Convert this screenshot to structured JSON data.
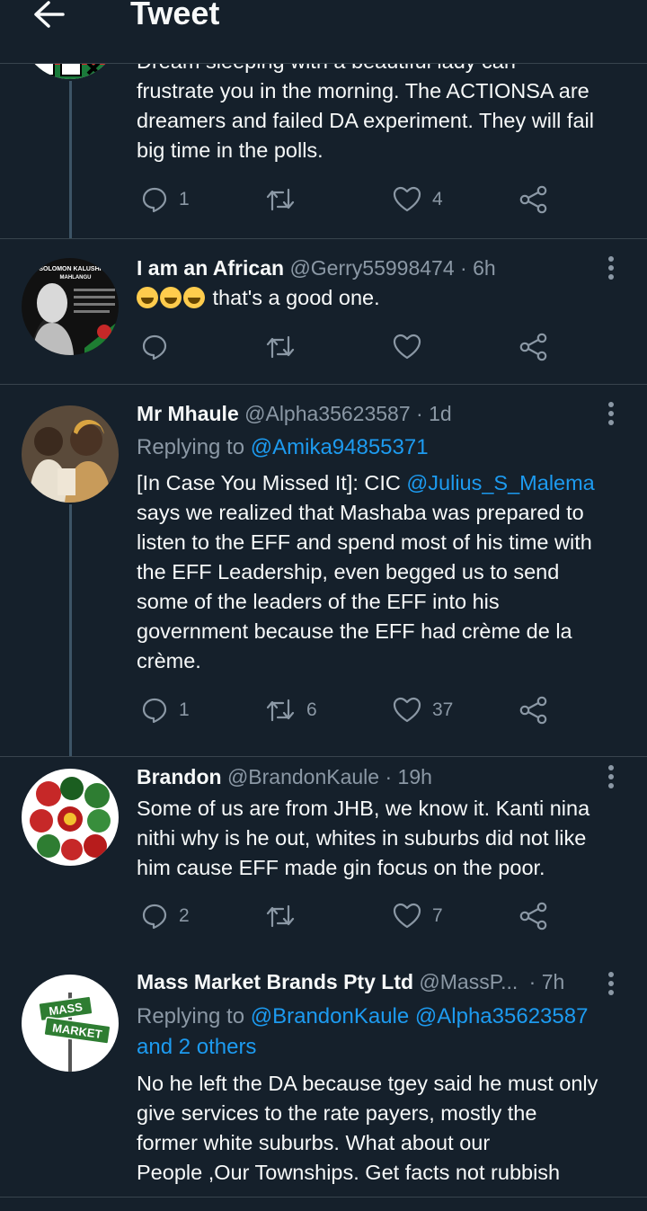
{
  "header": {
    "title": "Tweet"
  },
  "tweets": [
    {
      "body_lines": [
        "Dream sleeping with a beautiful lady can",
        "frustrate you in the morning. The ACTIONSA are",
        "dreamers and failed DA experiment. They will fail",
        "big time in the polls."
      ],
      "replies": "1",
      "retweets": "",
      "likes": "4"
    },
    {
      "name": "I am an African",
      "handle": "@Gerry55998474",
      "time": "· 6h",
      "body": "that's a good one.",
      "replies": "",
      "retweets": "",
      "likes": ""
    },
    {
      "name": "Mr Mhaule",
      "handle": "@Alpha35623587",
      "time": "· 1d",
      "replying_prefix": "Replying to",
      "replying_to": "@Amika94855371",
      "body_pre": "[In Case You Missed It]: CIC ",
      "body_mention": "@Julius_S_Malema",
      "body_lines": [
        "says we realized that Mashaba was prepared to",
        "listen to the EFF and spend most of his time with",
        "the EFF Leadership, even begged us to send",
        "some of the leaders of the EFF into his",
        "government because the EFF had crème de la",
        "crème."
      ],
      "replies": "1",
      "retweets": "6",
      "likes": "37"
    },
    {
      "name": "Brandon",
      "handle": "@BrandonKaule",
      "time": "· 19h",
      "body_lines": [
        "Some of us are from JHB, we know it. Kanti nina",
        "nithi why is he out, whites in suburbs did not like",
        "him cause EFF made gin focus on the poor."
      ],
      "replies": "2",
      "retweets": "",
      "likes": "7"
    },
    {
      "name": "Mass Market Brands Pty Ltd",
      "handle": "@MassP...",
      "time": "· 7h",
      "replying_prefix": "Replying to",
      "replying_to": "@BrandonKaule @Alpha35623587",
      "replying_more": "and 2 others",
      "body_lines": [
        "No he left the DA because tgey said he must only",
        "give services to the rate payers, mostly the",
        "former white suburbs. What about our",
        "People ,Our Townships. Get facts not rubbish"
      ]
    }
  ],
  "avatars": {
    "african_text": [
      "SOLOMON KALUSHI",
      "MAHLANGU"
    ],
    "mass_market_sign": [
      "MASS",
      "MARKET"
    ]
  },
  "colors": {
    "background": "#15202b",
    "text": "#f7f9f9",
    "muted": "#8b98a5",
    "link": "#1d9bf0",
    "divider": "#38444d"
  }
}
